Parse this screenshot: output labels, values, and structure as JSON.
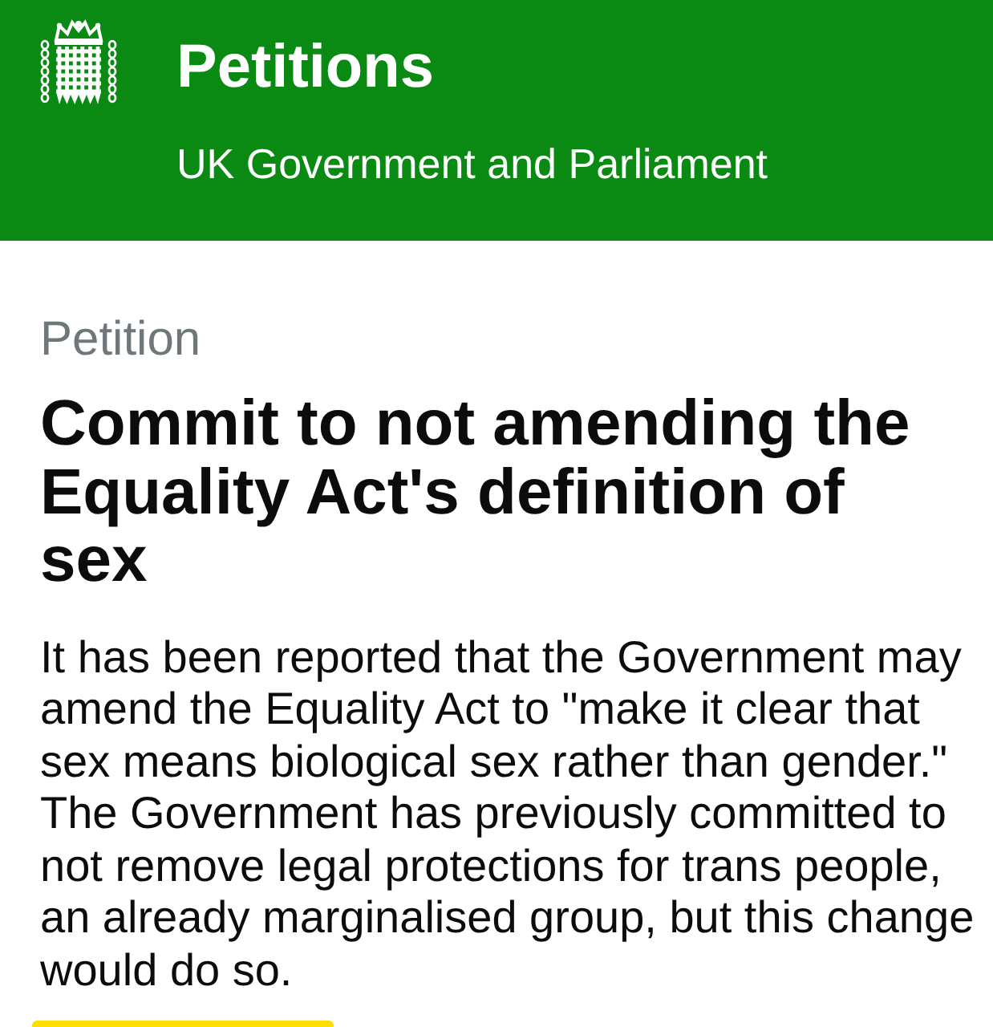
{
  "header": {
    "title": "Petitions",
    "subtitle": "UK Government and Parliament"
  },
  "petition": {
    "label": "Petition",
    "title": "Commit to not amending the Equality Act's definition of sex",
    "description": "It has been reported that the Government may amend the Equality Act to \"make it clear that sex means biological sex rather than gender.\" The Government has previously committed to not remove legal protections for trans people, an already marginalised group, but this change would do so."
  }
}
